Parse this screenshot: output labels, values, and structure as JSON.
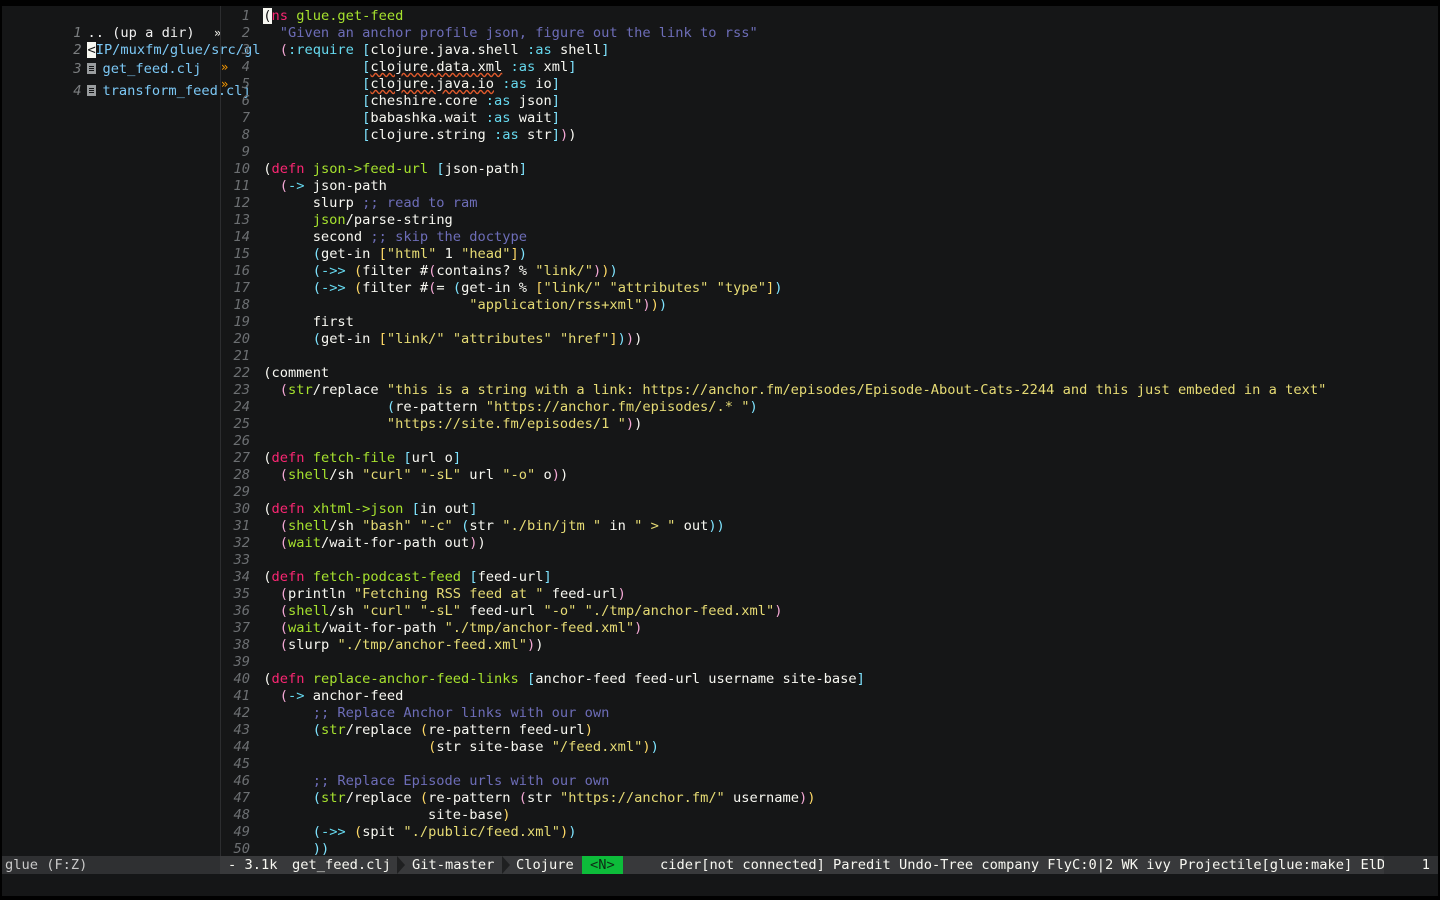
{
  "sidebar": {
    "rows": [
      {
        "num": "1",
        "text": ".. (up a dir)",
        "kind": "dir"
      },
      {
        "num": "2",
        "text": "IP/muxfm/glue/src/gl",
        "cursor_char": "<",
        "kind": "path"
      },
      {
        "num": "3",
        "text": "get_feed.clj",
        "kind": "file"
      },
      {
        "num": "4",
        "text": "transform_feed.clj",
        "kind": "file"
      }
    ]
  },
  "editor": {
    "lines": [
      [
        [
          "cur",
          "("
        ],
        [
          "kw",
          "ns"
        ],
        [
          "p1",
          " "
        ],
        [
          "fn",
          "glue.get-feed"
        ]
      ],
      [
        [
          "p1",
          "  "
        ],
        [
          "cm",
          "\"Given an anchor profile json, figure out the link to rss\""
        ]
      ],
      [
        [
          "p1",
          "  "
        ],
        [
          "p2",
          "("
        ],
        [
          "kwd",
          ":require"
        ],
        [
          "p1",
          " "
        ],
        [
          "p3",
          "["
        ],
        [
          "p1",
          "clojure.java.shell "
        ],
        [
          "kwd",
          ":as"
        ],
        [
          "p1",
          " shell"
        ],
        [
          "p3",
          "]"
        ]
      ],
      [
        [
          "p1",
          "            "
        ],
        [
          "p3",
          "["
        ],
        [
          "undl",
          "clojure.data.xml"
        ],
        [
          "p1",
          " "
        ],
        [
          "kwd",
          ":as"
        ],
        [
          "p1",
          " xml"
        ],
        [
          "p3",
          "]"
        ]
      ],
      [
        [
          "p1",
          "            "
        ],
        [
          "p3",
          "["
        ],
        [
          "undl",
          "clojure.java.io"
        ],
        [
          "p1",
          " "
        ],
        [
          "kwd",
          ":as"
        ],
        [
          "p1",
          " io"
        ],
        [
          "p3",
          "]"
        ]
      ],
      [
        [
          "p1",
          "            "
        ],
        [
          "p3",
          "["
        ],
        [
          "p1",
          "cheshire.core "
        ],
        [
          "kwd",
          ":as"
        ],
        [
          "p1",
          " json"
        ],
        [
          "p3",
          "]"
        ]
      ],
      [
        [
          "p1",
          "            "
        ],
        [
          "p3",
          "["
        ],
        [
          "p1",
          "babashka.wait "
        ],
        [
          "kwd",
          ":as"
        ],
        [
          "p1",
          " wait"
        ],
        [
          "p3",
          "]"
        ]
      ],
      [
        [
          "p1",
          "            "
        ],
        [
          "p3",
          "["
        ],
        [
          "p1",
          "clojure.string "
        ],
        [
          "kwd",
          ":as"
        ],
        [
          "p1",
          " str"
        ],
        [
          "p3",
          "]"
        ],
        [
          "p2",
          ")"
        ],
        [
          "p1",
          ")"
        ]
      ],
      [],
      [
        [
          "p1",
          "("
        ],
        [
          "kw",
          "defn"
        ],
        [
          "p1",
          " "
        ],
        [
          "fn",
          "json->feed-url"
        ],
        [
          "p1",
          " "
        ],
        [
          "p3",
          "["
        ],
        [
          "p1",
          "json-path"
        ],
        [
          "p3",
          "]"
        ]
      ],
      [
        [
          "p1",
          "  "
        ],
        [
          "p2",
          "("
        ],
        [
          "kwd",
          "->"
        ],
        [
          "p1",
          " json-path"
        ]
      ],
      [
        [
          "p1",
          "      slurp "
        ],
        [
          "cm",
          ";; read to ram"
        ]
      ],
      [
        [
          "p1",
          "      "
        ],
        [
          "fn",
          "json"
        ],
        [
          "p1",
          "/parse-string"
        ]
      ],
      [
        [
          "p1",
          "      second "
        ],
        [
          "cm",
          ";; skip the doctype"
        ]
      ],
      [
        [
          "p1",
          "      "
        ],
        [
          "p3",
          "("
        ],
        [
          "p1",
          "get-in "
        ],
        [
          "p4",
          "["
        ],
        [
          "str",
          "\"html\""
        ],
        [
          "p1",
          " 1 "
        ],
        [
          "str",
          "\"head\""
        ],
        [
          "p4",
          "]"
        ],
        [
          "p3",
          ")"
        ]
      ],
      [
        [
          "p1",
          "      "
        ],
        [
          "p3",
          "("
        ],
        [
          "kwd",
          "->>"
        ],
        [
          "p1",
          " "
        ],
        [
          "p4",
          "("
        ],
        [
          "p1",
          "filter #"
        ],
        [
          "p2",
          "("
        ],
        [
          "p1",
          "contains? % "
        ],
        [
          "str",
          "\"link/\""
        ],
        [
          "p2",
          ")"
        ],
        [
          "p4",
          ")"
        ],
        [
          "p3",
          ")"
        ]
      ],
      [
        [
          "p1",
          "      "
        ],
        [
          "p3",
          "("
        ],
        [
          "kwd",
          "->>"
        ],
        [
          "p1",
          " "
        ],
        [
          "p4",
          "("
        ],
        [
          "p1",
          "filter #"
        ],
        [
          "p2",
          "("
        ],
        [
          "p1",
          "= "
        ],
        [
          "p3",
          "("
        ],
        [
          "p1",
          "get-in % "
        ],
        [
          "p4",
          "["
        ],
        [
          "str",
          "\"link/\" \"attributes\" \"type\""
        ],
        [
          "p4",
          "]"
        ],
        [
          "p3",
          ")"
        ]
      ],
      [
        [
          "p1",
          "                         "
        ],
        [
          "str",
          "\"application/rss+xml\""
        ],
        [
          "p2",
          ")"
        ],
        [
          "p4",
          ")"
        ],
        [
          "p3",
          ")"
        ]
      ],
      [
        [
          "p1",
          "      first"
        ]
      ],
      [
        [
          "p1",
          "      "
        ],
        [
          "p3",
          "("
        ],
        [
          "p1",
          "get-in "
        ],
        [
          "p4",
          "["
        ],
        [
          "str",
          "\"link/\" \"attributes\" \"href\""
        ],
        [
          "p4",
          "]"
        ],
        [
          "p3",
          ")"
        ],
        [
          "p2",
          ")"
        ],
        [
          "p1",
          ")"
        ]
      ],
      [],
      [
        [
          "p1",
          "(comment"
        ]
      ],
      [
        [
          "p1",
          "  "
        ],
        [
          "p2",
          "("
        ],
        [
          "fn",
          "str"
        ],
        [
          "p1",
          "/replace "
        ],
        [
          "str",
          "\"this is a string with a link: https://anchor.fm/episodes/Episode-About-Cats-2244 and this just embeded in a text\""
        ]
      ],
      [
        [
          "p1",
          "               "
        ],
        [
          "p3",
          "("
        ],
        [
          "p1",
          "re-pattern "
        ],
        [
          "str",
          "\"https://anchor.fm/episodes/.* \""
        ],
        [
          "p3",
          ")"
        ]
      ],
      [
        [
          "p1",
          "               "
        ],
        [
          "str",
          "\"https://site.fm/episodes/1 \""
        ],
        [
          "p2",
          ")"
        ],
        [
          "p1",
          ")"
        ]
      ],
      [],
      [
        [
          "p1",
          "("
        ],
        [
          "kw",
          "defn"
        ],
        [
          "p1",
          " "
        ],
        [
          "fn",
          "fetch-file"
        ],
        [
          "p1",
          " "
        ],
        [
          "p3",
          "["
        ],
        [
          "p1",
          "url o"
        ],
        [
          "p3",
          "]"
        ]
      ],
      [
        [
          "p1",
          "  "
        ],
        [
          "p2",
          "("
        ],
        [
          "fn",
          "shell"
        ],
        [
          "p1",
          "/sh "
        ],
        [
          "str",
          "\"curl\" \"-sL\""
        ],
        [
          "p1",
          " url "
        ],
        [
          "str",
          "\"-o\""
        ],
        [
          "p1",
          " o"
        ],
        [
          "p2",
          ")"
        ],
        [
          "p1",
          ")"
        ]
      ],
      [],
      [
        [
          "p1",
          "("
        ],
        [
          "kw",
          "defn"
        ],
        [
          "p1",
          " "
        ],
        [
          "fn",
          "xhtml->json"
        ],
        [
          "p1",
          " "
        ],
        [
          "p3",
          "["
        ],
        [
          "p1",
          "in out"
        ],
        [
          "p3",
          "]"
        ]
      ],
      [
        [
          "p1",
          "  "
        ],
        [
          "p2",
          "("
        ],
        [
          "fn",
          "shell"
        ],
        [
          "p1",
          "/sh "
        ],
        [
          "str",
          "\"bash\" \"-c\""
        ],
        [
          "p1",
          " "
        ],
        [
          "p3",
          "("
        ],
        [
          "p1",
          "str "
        ],
        [
          "str",
          "\"./bin/jtm \""
        ],
        [
          "p1",
          " in "
        ],
        [
          "str",
          "\" > \""
        ],
        [
          "p1",
          " out"
        ],
        [
          "p3",
          "))"
        ]
      ],
      [
        [
          "p1",
          "  "
        ],
        [
          "p2",
          "("
        ],
        [
          "fn",
          "wait"
        ],
        [
          "p1",
          "/wait-for-path out"
        ],
        [
          "p2",
          ")"
        ],
        [
          "p1",
          ")"
        ]
      ],
      [],
      [
        [
          "p1",
          "("
        ],
        [
          "kw",
          "defn"
        ],
        [
          "p1",
          " "
        ],
        [
          "fn",
          "fetch-podcast-feed"
        ],
        [
          "p1",
          " "
        ],
        [
          "p3",
          "["
        ],
        [
          "p1",
          "feed-url"
        ],
        [
          "p3",
          "]"
        ]
      ],
      [
        [
          "p1",
          "  "
        ],
        [
          "p2",
          "("
        ],
        [
          "p1",
          "println "
        ],
        [
          "str",
          "\"Fetching RSS feed at \""
        ],
        [
          "p1",
          " feed-url"
        ],
        [
          "p2",
          ")"
        ]
      ],
      [
        [
          "p1",
          "  "
        ],
        [
          "p2",
          "("
        ],
        [
          "fn",
          "shell"
        ],
        [
          "p1",
          "/sh "
        ],
        [
          "str",
          "\"curl\" \"-sL\""
        ],
        [
          "p1",
          " feed-url "
        ],
        [
          "str",
          "\"-o\" \"./tmp/anchor-feed.xml\""
        ],
        [
          "p2",
          ")"
        ]
      ],
      [
        [
          "p1",
          "  "
        ],
        [
          "p2",
          "("
        ],
        [
          "fn",
          "wait"
        ],
        [
          "p1",
          "/wait-for-path "
        ],
        [
          "str",
          "\"./tmp/anchor-feed.xml\""
        ],
        [
          "p2",
          ")"
        ]
      ],
      [
        [
          "p1",
          "  "
        ],
        [
          "p2",
          "("
        ],
        [
          "p1",
          "slurp "
        ],
        [
          "str",
          "\"./tmp/anchor-feed.xml\""
        ],
        [
          "p2",
          ")"
        ],
        [
          "p1",
          ")"
        ]
      ],
      [],
      [
        [
          "p1",
          "("
        ],
        [
          "kw",
          "defn"
        ],
        [
          "p1",
          " "
        ],
        [
          "fn",
          "replace-anchor-feed-links"
        ],
        [
          "p1",
          " "
        ],
        [
          "p3",
          "["
        ],
        [
          "p1",
          "anchor-feed feed-url username site-base"
        ],
        [
          "p3",
          "]"
        ]
      ],
      [
        [
          "p1",
          "  "
        ],
        [
          "p2",
          "("
        ],
        [
          "kwd",
          "->"
        ],
        [
          "p1",
          " anchor-feed"
        ]
      ],
      [
        [
          "p1",
          "      "
        ],
        [
          "cm",
          ";; Replace Anchor links with our own"
        ]
      ],
      [
        [
          "p1",
          "      "
        ],
        [
          "p3",
          "("
        ],
        [
          "fn",
          "str"
        ],
        [
          "p1",
          "/replace "
        ],
        [
          "p4",
          "("
        ],
        [
          "p1",
          "re-pattern feed-url"
        ],
        [
          "p4",
          ")"
        ]
      ],
      [
        [
          "p1",
          "                    "
        ],
        [
          "p4",
          "("
        ],
        [
          "p1",
          "str site-base "
        ],
        [
          "str",
          "\"/feed.xml\""
        ],
        [
          "p4",
          ")"
        ],
        [
          "p3",
          ")"
        ]
      ],
      [],
      [
        [
          "p1",
          "      "
        ],
        [
          "cm",
          ";; Replace Episode urls with our own"
        ]
      ],
      [
        [
          "p1",
          "      "
        ],
        [
          "p3",
          "("
        ],
        [
          "fn",
          "str"
        ],
        [
          "p1",
          "/replace "
        ],
        [
          "p4",
          "("
        ],
        [
          "p1",
          "re-pattern "
        ],
        [
          "p2",
          "("
        ],
        [
          "p1",
          "str "
        ],
        [
          "str",
          "\"https://anchor.fm/\""
        ],
        [
          "p1",
          " username"
        ],
        [
          "p2",
          ")"
        ],
        [
          "p4",
          ")"
        ]
      ],
      [
        [
          "p1",
          "                    site-base"
        ],
        [
          "p4",
          ")"
        ]
      ],
      [
        [
          "p1",
          "      "
        ],
        [
          "p3",
          "("
        ],
        [
          "kwd",
          "->>"
        ],
        [
          "p1",
          " "
        ],
        [
          "p4",
          "("
        ],
        [
          "p1",
          "spit "
        ],
        [
          "str",
          "\"./public/feed.xml\""
        ],
        [
          "p4",
          ")"
        ],
        [
          "p3",
          ")"
        ]
      ],
      [
        [
          "p1",
          "      "
        ],
        [
          "p3",
          "))"
        ]
      ]
    ]
  },
  "modeline": {
    "left": "glue (F:Z)",
    "size": "- 3.1k",
    "buffer": "get_feed.clj",
    "vc": "Git-master",
    "major_mode": "Clojure",
    "evil_state": "<N>",
    "minor_modes": "cider[not connected] Paredit Undo-Tree company FlyC:0|2 WK ivy Projectile[glue:make] ElDoc",
    "right": "1"
  },
  "colors": {
    "background": "#151617",
    "keyword": "#f92672",
    "function": "#a6e22e",
    "string": "#e6db74",
    "builtin": "#66d9ef",
    "comment": "#6d6db8",
    "state_green": "#0dbc3a"
  }
}
